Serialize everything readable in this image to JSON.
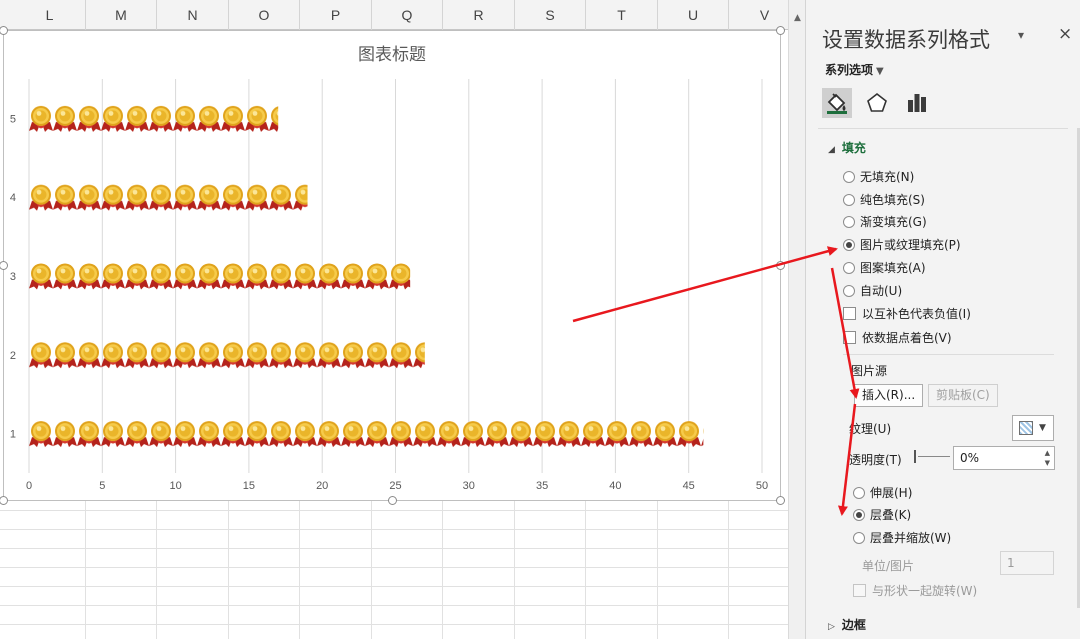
{
  "sheet": {
    "columns": [
      {
        "label": "L",
        "w": 72
      },
      {
        "label": "M",
        "w": 71
      },
      {
        "label": "N",
        "w": 72
      },
      {
        "label": "O",
        "w": 71
      },
      {
        "label": "P",
        "w": 72
      },
      {
        "label": "Q",
        "w": 71
      },
      {
        "label": "R",
        "w": 72
      },
      {
        "label": "S",
        "w": 71
      },
      {
        "label": "T",
        "w": 72
      },
      {
        "label": "U",
        "w": 71
      },
      {
        "label": "V",
        "w": 72
      }
    ]
  },
  "chart_data": {
    "type": "bar",
    "title": "图表标题",
    "categories": [
      "1",
      "2",
      "3",
      "4",
      "5"
    ],
    "values": [
      46,
      27,
      26,
      19,
      17
    ],
    "xlim": [
      0,
      50
    ],
    "xticks": [
      "0",
      "5",
      "10",
      "15",
      "20",
      "25",
      "30",
      "35",
      "40",
      "45",
      "50"
    ],
    "grid": true,
    "orientation": "horizontal",
    "fill": "picture-stacked",
    "picture": "gold-medal-icon"
  },
  "pane": {
    "title": "设置数据系列格式",
    "collapse_icon": "▾",
    "close_icon": "×",
    "series_options": "系列选项",
    "series_options_caret": "▼",
    "fill_section": "填充",
    "fill_options": [
      "无填充(N)",
      "纯色填充(S)",
      "渐变填充(G)",
      "图片或纹理填充(P)",
      "图案填充(A)",
      "自动(U)"
    ],
    "selected_fill": "图片或纹理填充(P)",
    "invert_negative": "以互补色代表负值(I)",
    "vary_colors": "依数据点着色(V)",
    "picture_source": "图片源",
    "insert_button": "插入(R)...",
    "clipboard_button": "剪贴板(C)",
    "texture_label": "纹理(U)",
    "transparency_label": "透明度(T)",
    "transparency_value": "0%",
    "stretch": "伸展(H)",
    "stack": "层叠(K)",
    "stack_scale": "层叠并缩放(W)",
    "unit_label": "单位/图片",
    "unit_value": "1",
    "rotate_with_shape": "与形状一起旋转(W)",
    "border_section": "边框",
    "accent_color": "#1e6f3d",
    "arrow_color": "#e8181e"
  }
}
